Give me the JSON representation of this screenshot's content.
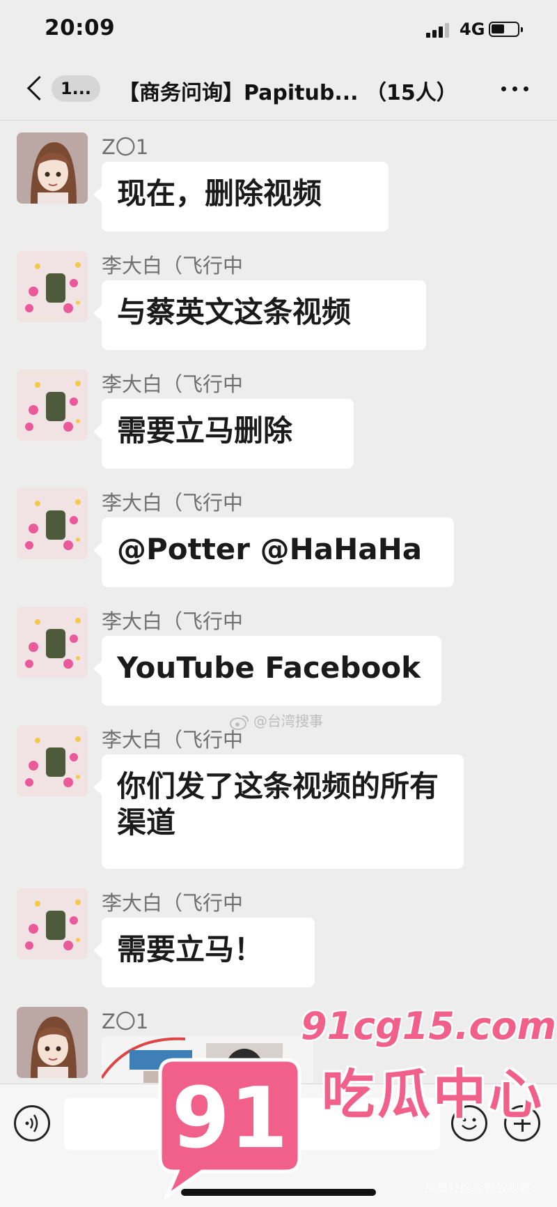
{
  "status_bar": {
    "time": "20:09",
    "network": "4G"
  },
  "nav": {
    "back_badge": "1...",
    "title": "【商务问询】Papitub... （15人）"
  },
  "messages": [
    {
      "sender": "Z〇1",
      "avatar": "girl-avatar",
      "text": "现在，删除视频"
    },
    {
      "sender": "李大白（飞行中",
      "avatar": "flower-avatar",
      "text": "与蔡英文这条视频"
    },
    {
      "sender": "李大白（飞行中",
      "avatar": "flower-avatar",
      "text": "需要立马删除"
    },
    {
      "sender": "李大白（飞行中",
      "avatar": "flower-avatar",
      "text": "@Potter @HaHaHa"
    },
    {
      "sender": "李大白（飞行中",
      "avatar": "flower-avatar",
      "text": "YouTube Facebook"
    },
    {
      "sender": "李大白（飞行中",
      "avatar": "flower-avatar",
      "text": "你们发了这条视频的所有渠道"
    },
    {
      "sender": "李大白（飞行中",
      "avatar": "flower-avatar",
      "text": "需要立马！"
    },
    {
      "sender": "Z〇1",
      "avatar": "girl-avatar",
      "type": "image"
    }
  ],
  "watermarks": {
    "weibo": "@台湾搜事",
    "site_url": "91cg15.com",
    "site_number": "91",
    "site_name": "吃瓜中心",
    "footer": "凤凰社区@蚂蚁观察"
  },
  "colors": {
    "background": "#ededed",
    "bubble": "#ffffff",
    "watermark_pink": "#f0608a"
  }
}
